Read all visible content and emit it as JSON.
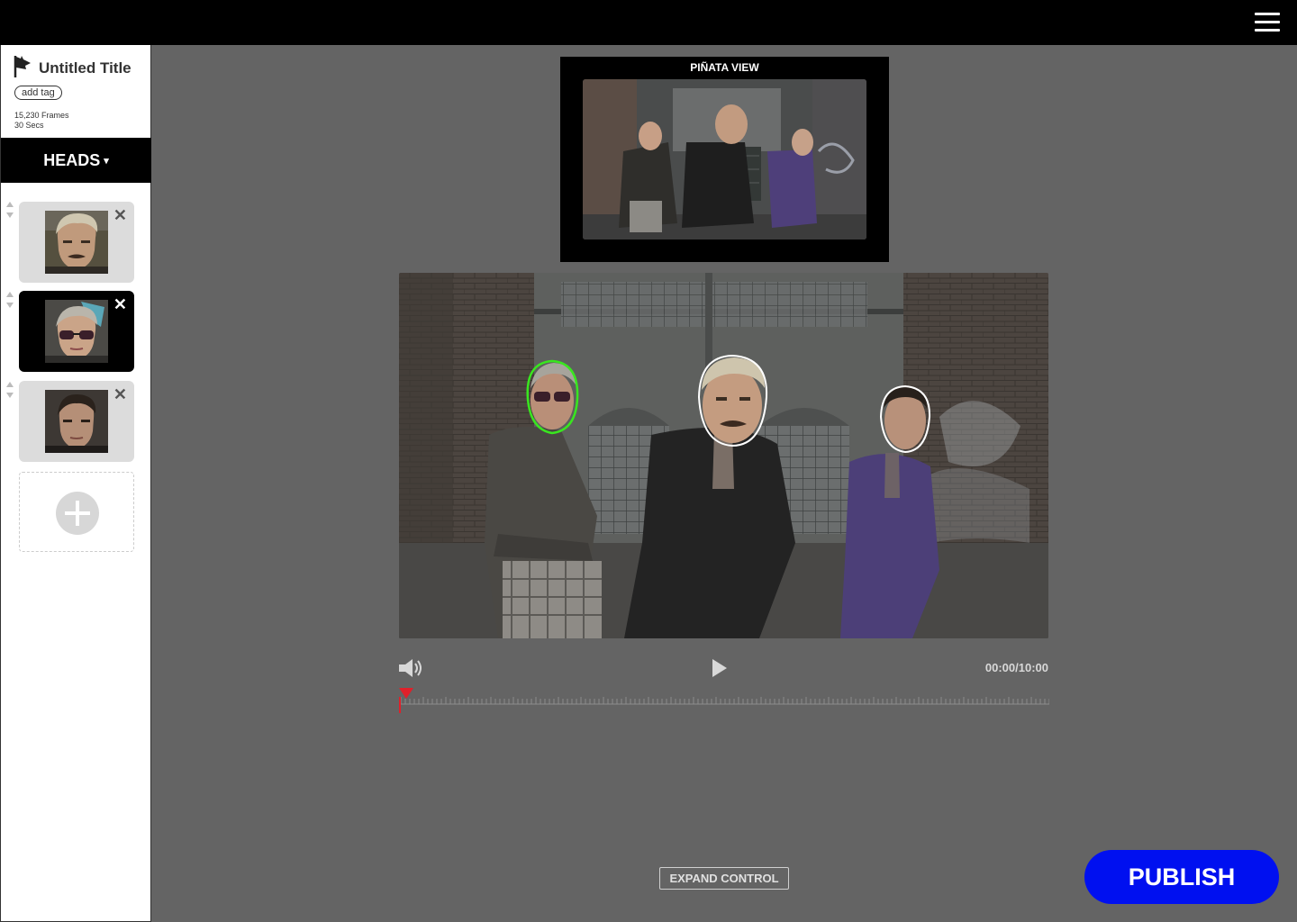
{
  "project": {
    "title": "Untitled Title",
    "add_tag_label": "add tag",
    "frames": "15,230 Frames",
    "duration": "30 Secs"
  },
  "heads_menu": {
    "label": "HEADS",
    "caret": "▾"
  },
  "heads": [
    {
      "name": "head-1",
      "selected": false
    },
    {
      "name": "head-2",
      "selected": true
    },
    {
      "name": "head-3",
      "selected": false
    }
  ],
  "close_glyph": "✕",
  "pinata_view": {
    "label": "PIÑATA VIEW"
  },
  "player": {
    "timecode": "00:00/10:00",
    "playhead_progress": 0
  },
  "expand_control_label": "EXPAND CONTROL",
  "publish_label": "PUBLISH",
  "colors": {
    "publish": "#0010f0",
    "playhead": "#e0202a",
    "selected_outline": "#39e61f",
    "face_outline": "#ffffff"
  },
  "icons": [
    "menu-icon",
    "flag-logo-icon",
    "close-icon",
    "sort-handle-icon",
    "add-icon",
    "volume-icon",
    "play-icon"
  ]
}
